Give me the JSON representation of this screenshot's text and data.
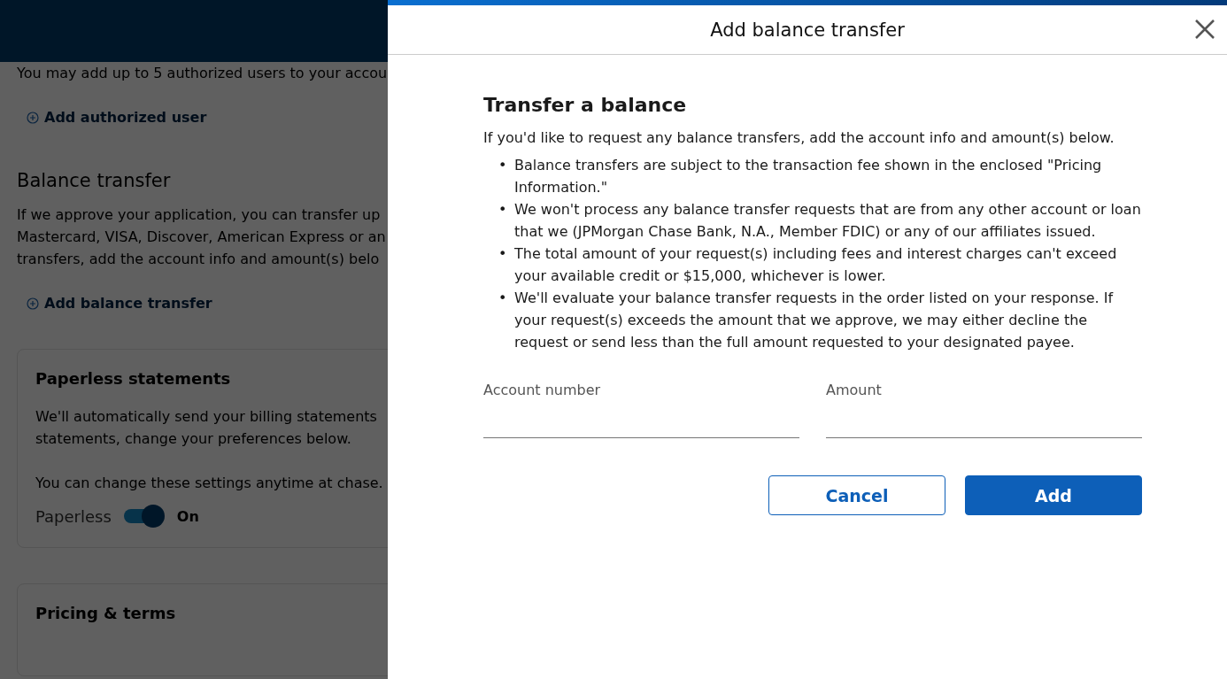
{
  "background_page": {
    "intro": "You may add up to 5 authorized users to your accou",
    "add_user_link": "Add authorized user",
    "balance_heading": "Balance transfer",
    "balance_lines": [
      "If we approve your application, you can transfer up",
      "Mastercard, VISA, Discover, American Express or an",
      "transfers, add the account info and amount(s) belo"
    ],
    "add_balance_link": "Add balance transfer",
    "paperless_card": {
      "title": "Paperless statements",
      "lines": [
        "We'll automatically send your billing statements",
        "statements, change your preferences below."
      ],
      "note": "You can change these settings anytime at chase.",
      "toggle_label": "Paperless",
      "on": true,
      "state_text": "On"
    },
    "pricing_card": {
      "title": "Pricing & terms"
    }
  },
  "dialog": {
    "title": "Add balance transfer",
    "heading": "Transfer a balance",
    "intro": "If you'd like to request any balance transfers, add the account info and amount(s) below.",
    "bullet_marker": "•",
    "bullets": [
      "Balance transfers are subject to the transaction fee shown in the enclosed \"Pricing Information.\"",
      "We won't process any balance transfer requests that are from any other account or loan that we (JPMorgan Chase Bank, N.A., Member FDIC) or any of our affiliates issued.",
      "The total amount of your request(s) including fees and interest charges can't exceed your available credit or $15,000, whichever is lower.",
      "We'll evaluate your balance transfer requests in the order listed on your response. If your request(s) exceeds the amount that we approve, we may either decline the request or send less than the full amount requested to your designated payee."
    ],
    "fields": [
      {
        "label": "Account number"
      },
      {
        "label": "Amount"
      }
    ],
    "buttons": [
      {
        "label": "Cancel",
        "kind": "secondary"
      },
      {
        "label": "Add",
        "kind": "primary"
      }
    ]
  }
}
